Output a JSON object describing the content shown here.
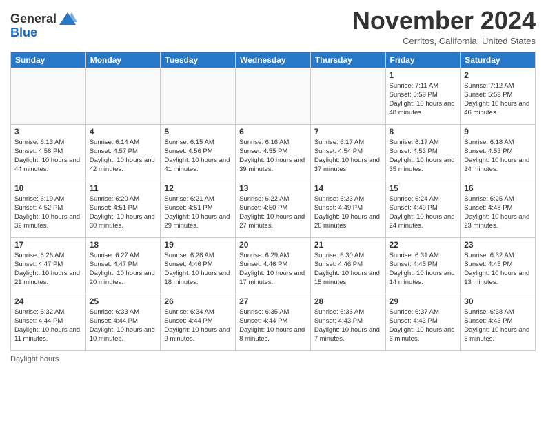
{
  "header": {
    "logo_line1": "General",
    "logo_line2": "Blue",
    "month_title": "November 2024",
    "location": "Cerritos, California, United States"
  },
  "days_of_week": [
    "Sunday",
    "Monday",
    "Tuesday",
    "Wednesday",
    "Thursday",
    "Friday",
    "Saturday"
  ],
  "weeks": [
    [
      {
        "day": "",
        "info": ""
      },
      {
        "day": "",
        "info": ""
      },
      {
        "day": "",
        "info": ""
      },
      {
        "day": "",
        "info": ""
      },
      {
        "day": "",
        "info": ""
      },
      {
        "day": "1",
        "info": "Sunrise: 7:11 AM\nSunset: 5:59 PM\nDaylight: 10 hours\nand 48 minutes."
      },
      {
        "day": "2",
        "info": "Sunrise: 7:12 AM\nSunset: 5:59 PM\nDaylight: 10 hours\nand 46 minutes."
      }
    ],
    [
      {
        "day": "3",
        "info": "Sunrise: 6:13 AM\nSunset: 4:58 PM\nDaylight: 10 hours\nand 44 minutes."
      },
      {
        "day": "4",
        "info": "Sunrise: 6:14 AM\nSunset: 4:57 PM\nDaylight: 10 hours\nand 42 minutes."
      },
      {
        "day": "5",
        "info": "Sunrise: 6:15 AM\nSunset: 4:56 PM\nDaylight: 10 hours\nand 41 minutes."
      },
      {
        "day": "6",
        "info": "Sunrise: 6:16 AM\nSunset: 4:55 PM\nDaylight: 10 hours\nand 39 minutes."
      },
      {
        "day": "7",
        "info": "Sunrise: 6:17 AM\nSunset: 4:54 PM\nDaylight: 10 hours\nand 37 minutes."
      },
      {
        "day": "8",
        "info": "Sunrise: 6:17 AM\nSunset: 4:53 PM\nDaylight: 10 hours\nand 35 minutes."
      },
      {
        "day": "9",
        "info": "Sunrise: 6:18 AM\nSunset: 4:53 PM\nDaylight: 10 hours\nand 34 minutes."
      }
    ],
    [
      {
        "day": "10",
        "info": "Sunrise: 6:19 AM\nSunset: 4:52 PM\nDaylight: 10 hours\nand 32 minutes."
      },
      {
        "day": "11",
        "info": "Sunrise: 6:20 AM\nSunset: 4:51 PM\nDaylight: 10 hours\nand 30 minutes."
      },
      {
        "day": "12",
        "info": "Sunrise: 6:21 AM\nSunset: 4:51 PM\nDaylight: 10 hours\nand 29 minutes."
      },
      {
        "day": "13",
        "info": "Sunrise: 6:22 AM\nSunset: 4:50 PM\nDaylight: 10 hours\nand 27 minutes."
      },
      {
        "day": "14",
        "info": "Sunrise: 6:23 AM\nSunset: 4:49 PM\nDaylight: 10 hours\nand 26 minutes."
      },
      {
        "day": "15",
        "info": "Sunrise: 6:24 AM\nSunset: 4:49 PM\nDaylight: 10 hours\nand 24 minutes."
      },
      {
        "day": "16",
        "info": "Sunrise: 6:25 AM\nSunset: 4:48 PM\nDaylight: 10 hours\nand 23 minutes."
      }
    ],
    [
      {
        "day": "17",
        "info": "Sunrise: 6:26 AM\nSunset: 4:47 PM\nDaylight: 10 hours\nand 21 minutes."
      },
      {
        "day": "18",
        "info": "Sunrise: 6:27 AM\nSunset: 4:47 PM\nDaylight: 10 hours\nand 20 minutes."
      },
      {
        "day": "19",
        "info": "Sunrise: 6:28 AM\nSunset: 4:46 PM\nDaylight: 10 hours\nand 18 minutes."
      },
      {
        "day": "20",
        "info": "Sunrise: 6:29 AM\nSunset: 4:46 PM\nDaylight: 10 hours\nand 17 minutes."
      },
      {
        "day": "21",
        "info": "Sunrise: 6:30 AM\nSunset: 4:46 PM\nDaylight: 10 hours\nand 15 minutes."
      },
      {
        "day": "22",
        "info": "Sunrise: 6:31 AM\nSunset: 4:45 PM\nDaylight: 10 hours\nand 14 minutes."
      },
      {
        "day": "23",
        "info": "Sunrise: 6:32 AM\nSunset: 4:45 PM\nDaylight: 10 hours\nand 13 minutes."
      }
    ],
    [
      {
        "day": "24",
        "info": "Sunrise: 6:32 AM\nSunset: 4:44 PM\nDaylight: 10 hours\nand 11 minutes."
      },
      {
        "day": "25",
        "info": "Sunrise: 6:33 AM\nSunset: 4:44 PM\nDaylight: 10 hours\nand 10 minutes."
      },
      {
        "day": "26",
        "info": "Sunrise: 6:34 AM\nSunset: 4:44 PM\nDaylight: 10 hours\nand 9 minutes."
      },
      {
        "day": "27",
        "info": "Sunrise: 6:35 AM\nSunset: 4:44 PM\nDaylight: 10 hours\nand 8 minutes."
      },
      {
        "day": "28",
        "info": "Sunrise: 6:36 AM\nSunset: 4:43 PM\nDaylight: 10 hours\nand 7 minutes."
      },
      {
        "day": "29",
        "info": "Sunrise: 6:37 AM\nSunset: 4:43 PM\nDaylight: 10 hours\nand 6 minutes."
      },
      {
        "day": "30",
        "info": "Sunrise: 6:38 AM\nSunset: 4:43 PM\nDaylight: 10 hours\nand 5 minutes."
      }
    ]
  ],
  "footer": {
    "label": "Daylight hours"
  }
}
